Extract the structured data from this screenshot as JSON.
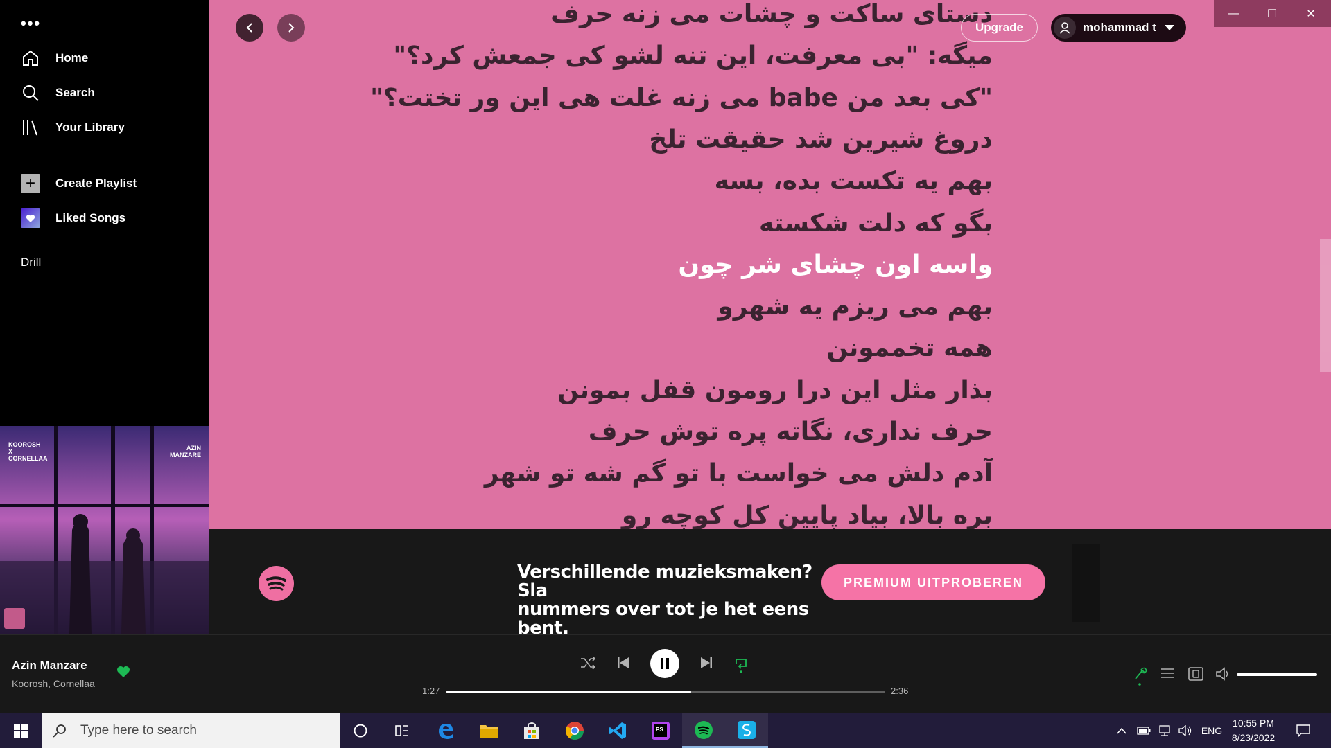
{
  "sidebar": {
    "menu_dots": "•••",
    "nav": [
      {
        "label": "Home",
        "icon": "home-icon"
      },
      {
        "label": "Search",
        "icon": "search-icon"
      },
      {
        "label": "Your Library",
        "icon": "library-icon"
      }
    ],
    "create_playlist": "Create Playlist",
    "liked_songs": "Liked Songs",
    "playlists": [
      "Drill"
    ],
    "album_art": {
      "left_text": "KOOROSH X CORNELLAA",
      "right_text": "AZIN MANZARE"
    }
  },
  "header": {
    "upgrade_label": "Upgrade",
    "user_name": "mohammad t",
    "window_controls": {
      "minimize": "—",
      "maximize": "☐",
      "close": "✕"
    }
  },
  "lyrics": {
    "active_index": 6,
    "lines": [
      "دستای ساکت و چشات می زنه حرف",
      "میگه: \"بی معرفت، این تنه لشو کی جمعش کرد؟\"",
      "\"کی بعد من babe می زنه غلت هی این ور تختت؟\"",
      "دروغ شیرین شد حقیقت تلخ",
      "بهم یه تکست بده، بسه",
      "بگو که دلت شکسته",
      "واسه اون چشای شر چون",
      "بهم می ریزم یه شهرو",
      "همه تخممونن",
      "بذار مثل این درا رومون قفل بمونن",
      "حرف نداری، نگاته پره توش حرف",
      "آدم دلش می خواست با تو گم شه تو شهر",
      "بره بالا، بیاد پایین کل کوچه رو"
    ]
  },
  "ad": {
    "text_line1": "Verschillende muzieksmaken? Sla",
    "text_line2": "nummers over tot je het eens bent.",
    "button_label": "PREMIUM UITPROBEREN"
  },
  "player": {
    "track_title": "Azin Manzare",
    "artists": "Koorosh, Cornellaa",
    "liked": true,
    "elapsed": "1:27",
    "duration": "2:36",
    "progress_fraction": 0.557,
    "volume_fraction": 1.0,
    "accent_color": "#1db954"
  },
  "taskbar": {
    "search_placeholder": "Type here to search",
    "apps": [
      "cortana-icon",
      "task-view-icon",
      "edge-icon",
      "file-explorer-icon",
      "store-icon",
      "chrome-icon",
      "vscode-icon",
      "phpstorm-icon",
      "spotify-icon",
      "app-icon"
    ],
    "language": "ENG",
    "time": "10:55 PM",
    "date": "8/23/2022"
  }
}
